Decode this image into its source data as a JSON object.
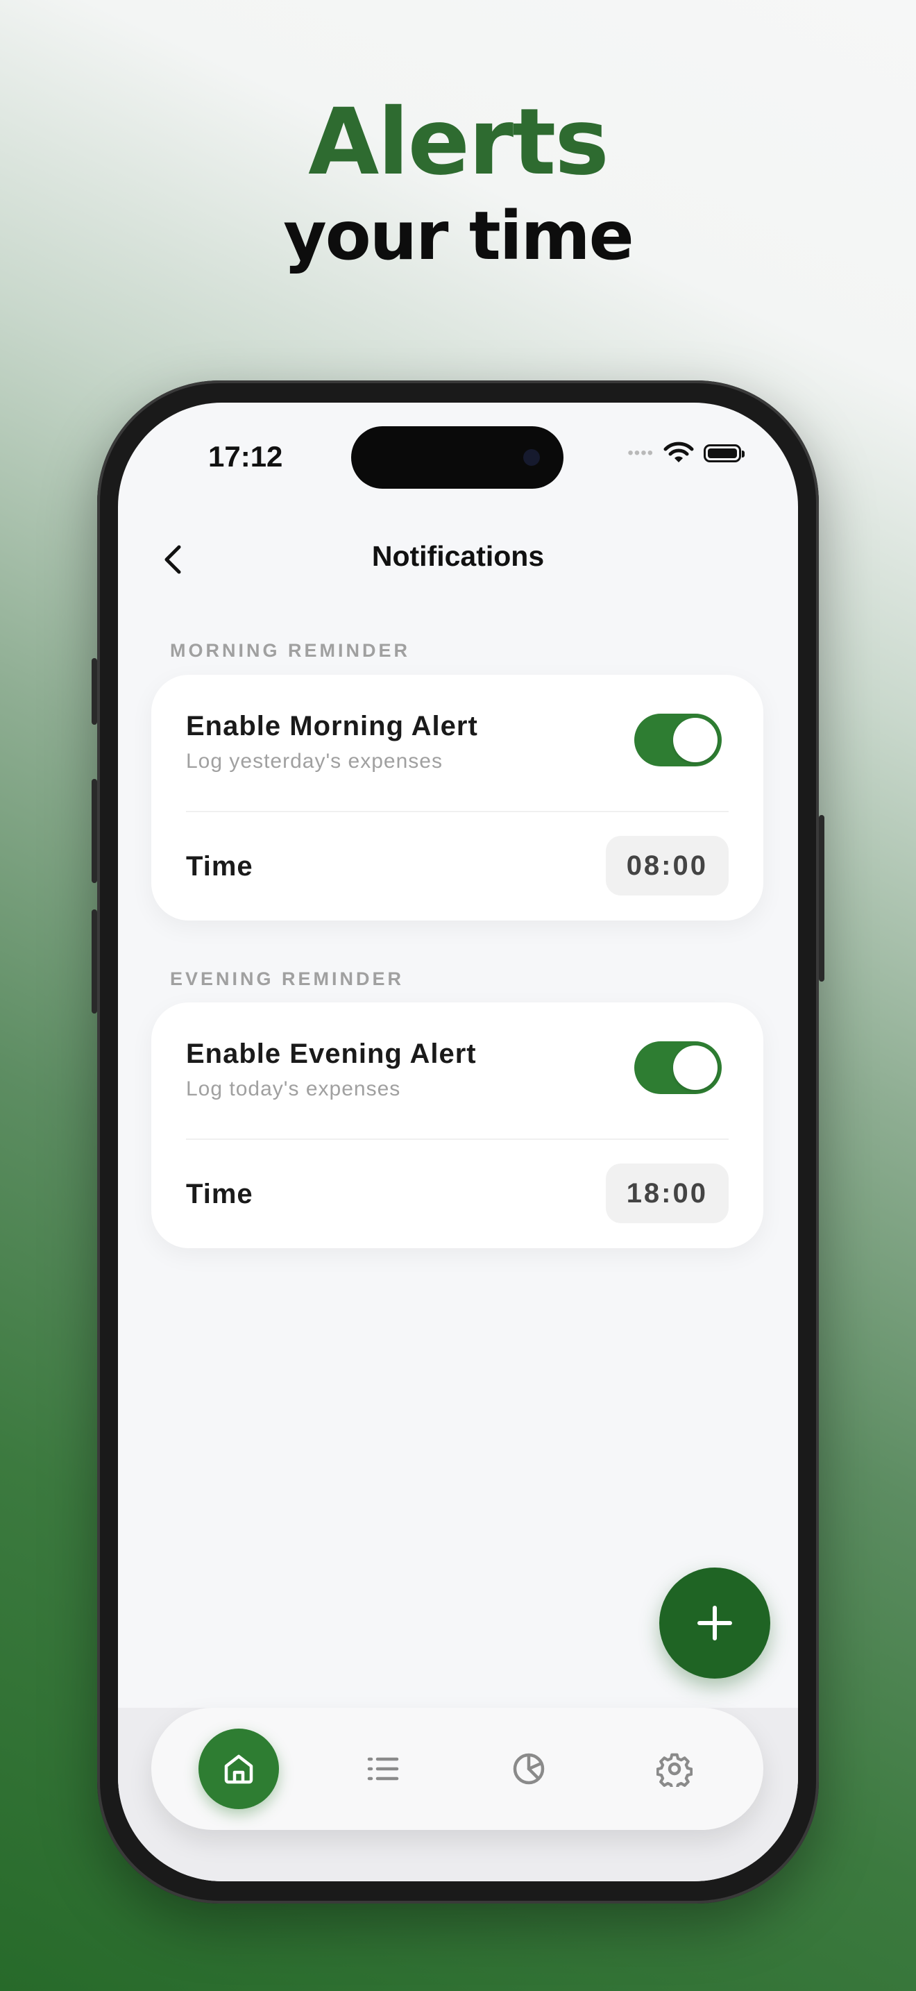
{
  "headline": {
    "title": "Alerts",
    "subtitle": "your time",
    "title_color": "#2e6b30"
  },
  "status_bar": {
    "time": "17:12",
    "signal_dots": "••••"
  },
  "nav": {
    "title": "Notifications"
  },
  "sections": [
    {
      "label": "MORNING REMINDER",
      "alert_title": "Enable Morning Alert",
      "alert_subtitle": "Log yesterday's expenses",
      "enabled": true,
      "time_label": "Time",
      "time_value": "08:00"
    },
    {
      "label": "EVENING REMINDER",
      "alert_title": "Enable Evening Alert",
      "alert_subtitle": "Log today's expenses",
      "enabled": true,
      "time_label": "Time",
      "time_value": "18:00"
    }
  ],
  "fab": {
    "icon": "plus-icon"
  },
  "tabbar": {
    "items": [
      {
        "icon": "home-icon",
        "active": true
      },
      {
        "icon": "list-icon",
        "active": false
      },
      {
        "icon": "pie-chart-icon",
        "active": false
      },
      {
        "icon": "gear-icon",
        "active": false
      }
    ]
  },
  "colors": {
    "accent": "#2e7d32",
    "fab": "#1f6424",
    "icon_inactive": "#8a8a8a"
  }
}
